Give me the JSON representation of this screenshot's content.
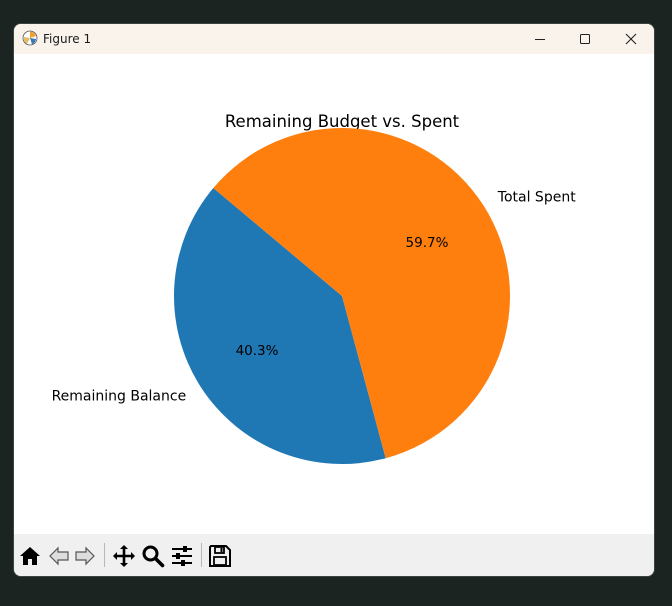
{
  "window": {
    "title": "Figure 1",
    "controls": [
      "minimize-icon",
      "maximize-icon",
      "close-icon"
    ]
  },
  "toolbar": {
    "tools": [
      "home-icon",
      "back-arrow-icon",
      "forward-arrow-icon",
      "pan-icon",
      "zoom-icon",
      "configure-subplots-icon",
      "save-icon"
    ]
  },
  "chart_data": {
    "type": "pie",
    "title": "Remaining Budget vs. Spent",
    "start_angle_deg": 140,
    "slices": [
      {
        "label": "Remaining Balance",
        "value": 40.3,
        "pct_label": "40.3%",
        "color": "#1f77b4"
      },
      {
        "label": "Total Spent",
        "value": 59.7,
        "pct_label": "59.7%",
        "color": "#ff7f0e"
      }
    ]
  }
}
